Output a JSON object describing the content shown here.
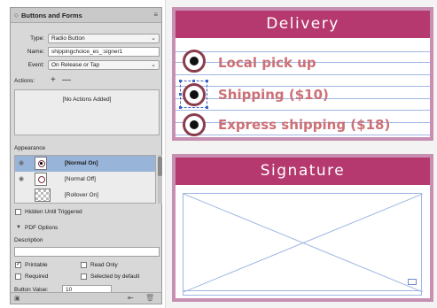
{
  "panel": {
    "title": "Buttons and Forms",
    "type_label": "Type:",
    "type_value": "Radio Button",
    "name_label": "Name:",
    "name_value": "shippingchoice_es_:signer1",
    "event_label": "Event:",
    "event_value": "On Release or Tap",
    "actions_label": "Actions:",
    "add_action": "+",
    "remove_action": "—",
    "no_actions": "[No Actions Added]",
    "appearance_label": "Appearance",
    "appearance_states": [
      {
        "label": "[Normal On]",
        "selected": true
      },
      {
        "label": "[Normal Off]",
        "selected": false
      },
      {
        "label": "[Rollover On]",
        "selected": false
      }
    ],
    "hidden_until_triggered": "Hidden Until Triggered",
    "pdf_options": "PDF Options",
    "description_label": "Description",
    "description_value": "",
    "printable": {
      "label": "Printable",
      "checked": true
    },
    "read_only": {
      "label": "Read Only",
      "checked": false
    },
    "required": {
      "label": "Required",
      "checked": false
    },
    "selected_by_default": {
      "label": "Selected by default",
      "checked": false
    },
    "button_value_label": "Button Value:",
    "button_value": "10"
  },
  "delivery": {
    "title": "Delivery",
    "options": [
      {
        "label": "Local pick up"
      },
      {
        "label": "Shipping ($10)"
      },
      {
        "label": "Express shipping ($18)"
      }
    ]
  },
  "signature": {
    "title": "Signature"
  },
  "colors": {
    "header_bg": "#b5396e",
    "card_border": "#c78fb1",
    "label_text": "#cc7076",
    "selection_blue": "#3f64c8",
    "row_highlight": "#98b4d8"
  }
}
